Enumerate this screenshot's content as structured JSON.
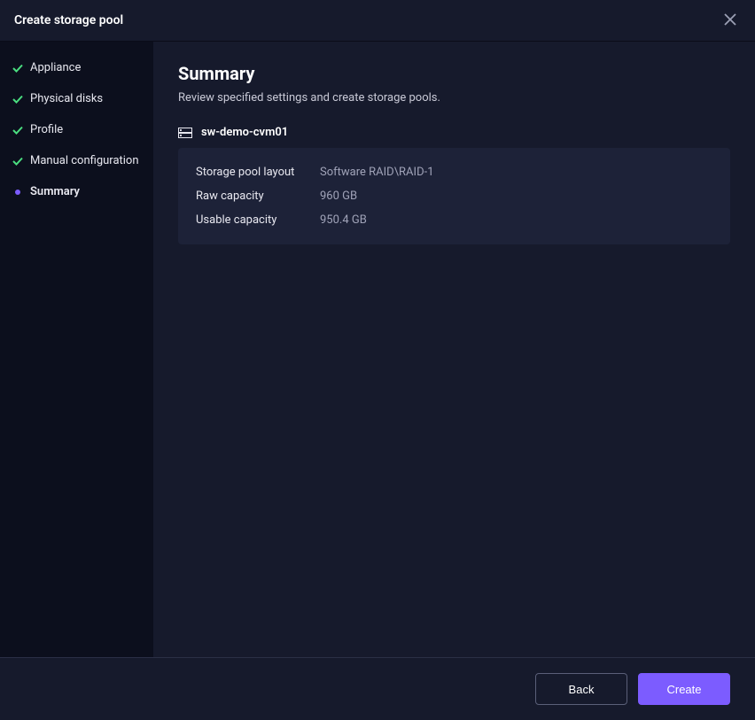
{
  "header": {
    "title": "Create storage pool"
  },
  "sidebar": {
    "items": [
      {
        "label": "Appliance",
        "state": "done"
      },
      {
        "label": "Physical disks",
        "state": "done"
      },
      {
        "label": "Profile",
        "state": "done"
      },
      {
        "label": "Manual configuration",
        "state": "done"
      },
      {
        "label": "Summary",
        "state": "active"
      }
    ]
  },
  "main": {
    "title": "Summary",
    "subtitle": "Review specified settings and create storage pools.",
    "device_name": "sw-demo-cvm01",
    "details": [
      {
        "label": "Storage pool layout",
        "value": "Software RAID\\RAID-1"
      },
      {
        "label": "Raw capacity",
        "value": "960 GB"
      },
      {
        "label": "Usable capacity",
        "value": "950.4 GB"
      }
    ]
  },
  "footer": {
    "back_label": "Back",
    "create_label": "Create"
  }
}
